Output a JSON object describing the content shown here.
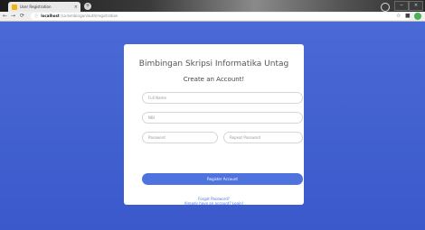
{
  "browser": {
    "tab_title": "User Registration",
    "url_host": "localhost",
    "url_path": "/sa-bimbingan/auth/registration"
  },
  "page": {
    "brand_title": "Bimbingan Skripsi Informatika Untag",
    "subtitle": "Create an Account!",
    "full_name_placeholder": "Full Name",
    "nbi_placeholder": "NBI",
    "password_placeholder": "Password",
    "repeat_password_placeholder": "Repeat Password",
    "register_button": "Register Account",
    "forgot_password_link": "Forgot Password?",
    "login_link": "Already have an account? Login!"
  },
  "colors": {
    "background": "#3f5fd0",
    "button": "#4e73df"
  }
}
